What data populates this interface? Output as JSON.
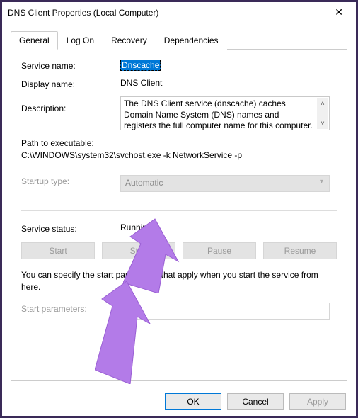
{
  "window": {
    "title": "DNS Client Properties (Local Computer)"
  },
  "tabs": [
    {
      "label": "General",
      "active": true
    },
    {
      "label": "Log On",
      "active": false
    },
    {
      "label": "Recovery",
      "active": false
    },
    {
      "label": "Dependencies",
      "active": false
    }
  ],
  "fields": {
    "service_name_label": "Service name:",
    "service_name_value": "Dnscache",
    "display_name_label": "Display name:",
    "display_name_value": "DNS Client",
    "description_label": "Description:",
    "description_value": "The DNS Client service (dnscache) caches Domain Name System (DNS) names and registers the full computer name for this computer. If the service is",
    "path_label": "Path to executable:",
    "path_value": "C:\\WINDOWS\\system32\\svchost.exe -k NetworkService -p",
    "startup_type_label": "Startup type:",
    "startup_type_value": "Automatic",
    "service_status_label": "Service status:",
    "service_status_value": "Running",
    "help_text": "You can specify the start parameters that apply when you start the service from here.",
    "start_params_label": "Start parameters:"
  },
  "service_buttons": {
    "start": "Start",
    "stop": "Stop",
    "pause": "Pause",
    "resume": "Resume"
  },
  "dialog_buttons": {
    "ok": "OK",
    "cancel": "Cancel",
    "apply": "Apply"
  },
  "annotation_color": "#b37be8"
}
